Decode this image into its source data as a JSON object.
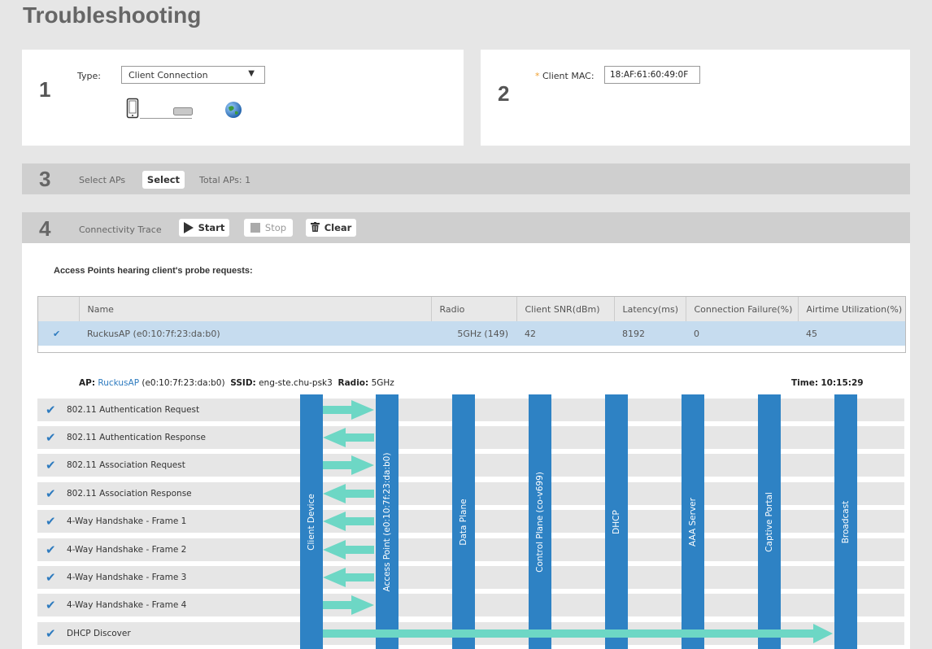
{
  "page": {
    "title": "Troubleshooting"
  },
  "step1": {
    "number": "1",
    "type_label": "Type:",
    "type_value": "Client Connection",
    "icons": [
      "phone-icon",
      "access-point-icon",
      "globe-icon"
    ]
  },
  "step2": {
    "number": "2",
    "required_mark": "*",
    "mac_label": "Client MAC:",
    "mac_value": "18:AF:61:60:49:0F"
  },
  "step3": {
    "number": "3",
    "select_aps_label": "Select APs",
    "select_button": "Select",
    "total_aps": "Total APs: 1"
  },
  "step4": {
    "number": "4",
    "trace_label": "Connectivity Trace",
    "start_button": "Start",
    "stop_button": "Stop",
    "clear_button": "Clear"
  },
  "probe_section": {
    "heading": "Access Points hearing client's probe requests:",
    "columns": [
      "Name",
      "Radio",
      "Client SNR(dBm)",
      "Latency(ms)",
      "Connection Failure(%)",
      "Airtime Utilization(%)"
    ],
    "rows": [
      {
        "check": "✔",
        "name": "RuckusAP (e0:10:7f:23:da:b0)",
        "radio": "5GHz (149)",
        "snr": "42",
        "latency": "8192",
        "failure": "0",
        "airtime": "45"
      }
    ]
  },
  "trace": {
    "ap_label": "AP:",
    "ap_name": "RuckusAP",
    "ap_mac": "(e0:10:7f:23:da:b0)",
    "ssid_label": "SSID:",
    "ssid_value": "eng-ste.chu-psk3",
    "radio_label": "Radio:",
    "radio_value": "5GHz",
    "time_label": "Time:",
    "time_value": "10:15:29",
    "check": "✔",
    "rows": [
      "802.11 Authentication Request",
      "802.11 Authentication Response",
      "802.11 Association Request",
      "802.11 Association Response",
      "4-Way Handshake - Frame 1",
      "4-Way Handshake - Frame 2",
      "4-Way Handshake - Frame 3",
      "4-Way Handshake - Frame 4",
      "DHCP Discover"
    ],
    "columns": [
      "Client Device",
      "Access Point (e0:10:7f:23:da:b0)",
      "Data Plane",
      "Control Plane (co-v699)",
      "DHCP",
      "AAA Server",
      "Captive Portal",
      "Broadcast"
    ],
    "colors": {
      "column": "#2e82c4",
      "arrow": "#6dd7c5",
      "check": "#2e7bbf"
    }
  }
}
